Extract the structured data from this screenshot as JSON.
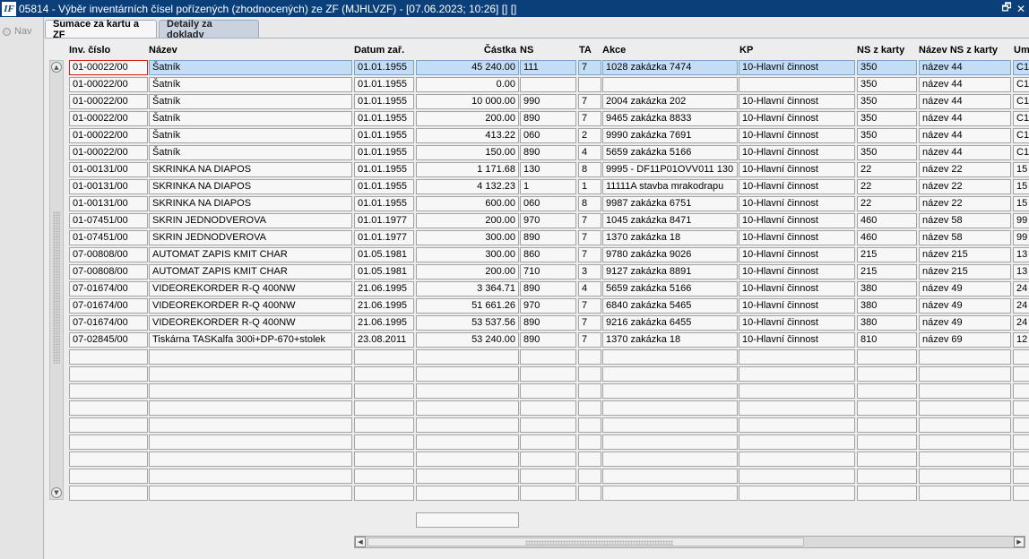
{
  "window": {
    "logo": "IF",
    "title": "05814 - Výběr inventárních čísel pořízených (zhodnocených) ze ZF (MJHLVZF) - [07.06.2023; 10:26]  []  []",
    "restore_glyph": "🗗",
    "close_glyph": "✕"
  },
  "left_panel": {
    "nav_label": "Nav"
  },
  "tabs": [
    {
      "label": "Sumace za kartu a ZF"
    },
    {
      "label": "Detaily za doklady"
    }
  ],
  "columns": {
    "inv": "Inv. číslo",
    "nazev": "Název",
    "datum": "Datum zař.",
    "castka": "Částka",
    "ns": "NS",
    "ta": "TA",
    "akce": "Akce",
    "kp": "KP",
    "nsk": "NS z karty",
    "nazevns": "Název NS z karty",
    "um": "Um"
  },
  "rows": [
    {
      "inv": "01-00022/00",
      "nazev": "Šatník",
      "datum": "01.01.1955",
      "castka": "45 240.00",
      "ns": "111",
      "ta": "7",
      "akce": "1028 zakázka 7474",
      "kp": "10-Hlavní činnost",
      "nsk": "350",
      "nazevns": "název 44",
      "um": "C1"
    },
    {
      "inv": "01-00022/00",
      "nazev": "Šatník",
      "datum": "01.01.1955",
      "castka": "0.00",
      "ns": "",
      "ta": "",
      "akce": "",
      "kp": "",
      "nsk": "350",
      "nazevns": "název 44",
      "um": "C1"
    },
    {
      "inv": "01-00022/00",
      "nazev": "Šatník",
      "datum": "01.01.1955",
      "castka": "10 000.00",
      "ns": "990",
      "ta": "7",
      "akce": "2004 zakázka 202",
      "kp": "10-Hlavní činnost",
      "nsk": "350",
      "nazevns": "název 44",
      "um": "C1"
    },
    {
      "inv": "01-00022/00",
      "nazev": "Šatník",
      "datum": "01.01.1955",
      "castka": "200.00",
      "ns": "890",
      "ta": "7",
      "akce": "9465 zakázka 8833",
      "kp": "10-Hlavní činnost",
      "nsk": "350",
      "nazevns": "název 44",
      "um": "C1"
    },
    {
      "inv": "01-00022/00",
      "nazev": "Šatník",
      "datum": "01.01.1955",
      "castka": "413.22",
      "ns": "060",
      "ta": "2",
      "akce": "9990 zakázka 7691",
      "kp": "10-Hlavní činnost",
      "nsk": "350",
      "nazevns": "název 44",
      "um": "C1"
    },
    {
      "inv": "01-00022/00",
      "nazev": "Šatník",
      "datum": "01.01.1955",
      "castka": "150.00",
      "ns": "890",
      "ta": "4",
      "akce": "5659 zakázka 5166",
      "kp": "10-Hlavní činnost",
      "nsk": "350",
      "nazevns": "název 44",
      "um": "C1"
    },
    {
      "inv": "01-00131/00",
      "nazev": "SKRINKA NA DIAPOS",
      "datum": "01.01.1955",
      "castka": "1 171.68",
      "ns": "130",
      "ta": "8",
      "akce": "9995 -  DF11P01OVV011 130",
      "kp": "10-Hlavní činnost",
      "nsk": "22",
      "nazevns": "název 22",
      "um": "15"
    },
    {
      "inv": "01-00131/00",
      "nazev": "SKRINKA NA DIAPOS",
      "datum": "01.01.1955",
      "castka": "4 132.23",
      "ns": "1",
      "ta": "1",
      "akce": "11111A stavba mrakodrapu",
      "kp": "10-Hlavní činnost",
      "nsk": "22",
      "nazevns": "název 22",
      "um": "15"
    },
    {
      "inv": "01-00131/00",
      "nazev": "SKRINKA NA DIAPOS",
      "datum": "01.01.1955",
      "castka": "600.00",
      "ns": "060",
      "ta": "8",
      "akce": "9987 zakázka 6751",
      "kp": "10-Hlavní činnost",
      "nsk": "22",
      "nazevns": "název 22",
      "um": "15"
    },
    {
      "inv": "01-07451/00",
      "nazev": "SKRIN JEDNODVEROVA",
      "datum": "01.01.1977",
      "castka": "200.00",
      "ns": "970",
      "ta": "7",
      "akce": "1045 zakázka 8471",
      "kp": "10-Hlavní činnost",
      "nsk": "460",
      "nazevns": "název 58",
      "um": "99"
    },
    {
      "inv": "01-07451/00",
      "nazev": "SKRIN JEDNODVEROVA",
      "datum": "01.01.1977",
      "castka": "300.00",
      "ns": "890",
      "ta": "7",
      "akce": "1370 zakázka 18",
      "kp": "10-Hlavní činnost",
      "nsk": "460",
      "nazevns": "název 58",
      "um": "99"
    },
    {
      "inv": "07-00808/00",
      "nazev": "AUTOMAT ZAPIS KMIT CHAR",
      "datum": "01.05.1981",
      "castka": "300.00",
      "ns": "860",
      "ta": "7",
      "akce": "9780 zakázka 9026",
      "kp": "10-Hlavní činnost",
      "nsk": "215",
      "nazevns": "název 215",
      "um": "13"
    },
    {
      "inv": "07-00808/00",
      "nazev": "AUTOMAT ZAPIS KMIT CHAR",
      "datum": "01.05.1981",
      "castka": "200.00",
      "ns": "710",
      "ta": "3",
      "akce": "9127 zakázka 8891",
      "kp": "10-Hlavní činnost",
      "nsk": "215",
      "nazevns": "název 215",
      "um": "13"
    },
    {
      "inv": "07-01674/00",
      "nazev": "VIDEOREKORDER R-Q 400NW",
      "datum": "21.06.1995",
      "castka": "3 364.71",
      "ns": "890",
      "ta": "4",
      "akce": "5659 zakázka 5166",
      "kp": "10-Hlavní činnost",
      "nsk": "380",
      "nazevns": "název 49",
      "um": "24"
    },
    {
      "inv": "07-01674/00",
      "nazev": "VIDEOREKORDER R-Q 400NW",
      "datum": "21.06.1995",
      "castka": "51 661.26",
      "ns": "970",
      "ta": "7",
      "akce": "6840 zakázka 5465",
      "kp": "10-Hlavní činnost",
      "nsk": "380",
      "nazevns": "název 49",
      "um": "24"
    },
    {
      "inv": "07-01674/00",
      "nazev": "VIDEOREKORDER R-Q 400NW",
      "datum": "21.06.1995",
      "castka": "53 537.56",
      "ns": "890",
      "ta": "7",
      "akce": "9216 zakázka 6455",
      "kp": "10-Hlavní činnost",
      "nsk": "380",
      "nazevns": "název 49",
      "um": "24"
    },
    {
      "inv": "07-02845/00",
      "nazev": "Tiskárna TASKalfa 300i+DP-670+stolek",
      "datum": "23.08.2011",
      "castka": "53 240.00",
      "ns": "890",
      "ta": "7",
      "akce": "1370 zakázka 18",
      "kp": "10-Hlavní činnost",
      "nsk": "810",
      "nazevns": "název 69",
      "um": "12"
    },
    {
      "inv": "",
      "nazev": "",
      "datum": "",
      "castka": "",
      "ns": "",
      "ta": "",
      "akce": "",
      "kp": "",
      "nsk": "",
      "nazevns": "",
      "um": ""
    },
    {
      "inv": "",
      "nazev": "",
      "datum": "",
      "castka": "",
      "ns": "",
      "ta": "",
      "akce": "",
      "kp": "",
      "nsk": "",
      "nazevns": "",
      "um": ""
    },
    {
      "inv": "",
      "nazev": "",
      "datum": "",
      "castka": "",
      "ns": "",
      "ta": "",
      "akce": "",
      "kp": "",
      "nsk": "",
      "nazevns": "",
      "um": ""
    },
    {
      "inv": "",
      "nazev": "",
      "datum": "",
      "castka": "",
      "ns": "",
      "ta": "",
      "akce": "",
      "kp": "",
      "nsk": "",
      "nazevns": "",
      "um": ""
    },
    {
      "inv": "",
      "nazev": "",
      "datum": "",
      "castka": "",
      "ns": "",
      "ta": "",
      "akce": "",
      "kp": "",
      "nsk": "",
      "nazevns": "",
      "um": ""
    },
    {
      "inv": "",
      "nazev": "",
      "datum": "",
      "castka": "",
      "ns": "",
      "ta": "",
      "akce": "",
      "kp": "",
      "nsk": "",
      "nazevns": "",
      "um": ""
    },
    {
      "inv": "",
      "nazev": "",
      "datum": "",
      "castka": "",
      "ns": "",
      "ta": "",
      "akce": "",
      "kp": "",
      "nsk": "",
      "nazevns": "",
      "um": ""
    },
    {
      "inv": "",
      "nazev": "",
      "datum": "",
      "castka": "",
      "ns": "",
      "ta": "",
      "akce": "",
      "kp": "",
      "nsk": "",
      "nazevns": "",
      "um": ""
    },
    {
      "inv": "",
      "nazev": "",
      "datum": "",
      "castka": "",
      "ns": "",
      "ta": "",
      "akce": "",
      "kp": "",
      "nsk": "",
      "nazevns": "",
      "um": ""
    }
  ],
  "selected_row": 0,
  "colors": {
    "titlebar": "#0a3f7a",
    "selection": "#c3ddf5",
    "focus_border": "#d31c1c"
  },
  "icons": {
    "scroll_up": "scroll-up-icon",
    "scroll_down": "scroll-down-icon",
    "scroll_left": "scroll-left-icon",
    "scroll_right": "scroll-right-icon"
  }
}
